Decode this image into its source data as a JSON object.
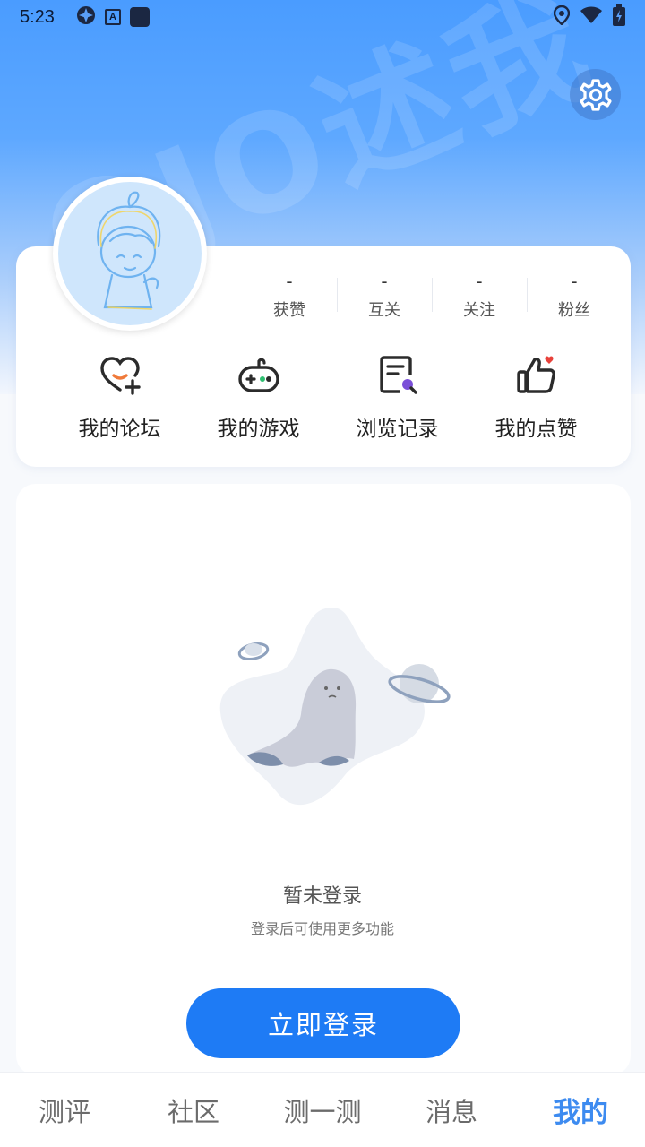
{
  "status_bar": {
    "time": "5:23"
  },
  "header": {
    "watermark_text": "OJO述我",
    "settings_icon": "gear-icon"
  },
  "profile": {
    "stats": [
      {
        "value": "-",
        "label": "获赞"
      },
      {
        "value": "-",
        "label": "互关"
      },
      {
        "value": "-",
        "label": "关注"
      },
      {
        "value": "-",
        "label": "粉丝"
      }
    ],
    "quick_actions": [
      {
        "label": "我的论坛",
        "icon": "heart-plus-icon"
      },
      {
        "label": "我的游戏",
        "icon": "gamepad-icon"
      },
      {
        "label": "浏览记录",
        "icon": "history-search-icon"
      },
      {
        "label": "我的点赞",
        "icon": "thumbs-up-icon"
      }
    ]
  },
  "empty_state": {
    "title": "暂未登录",
    "subtitle": "登录后可使用更多功能",
    "login_button": "立即登录"
  },
  "tabs": [
    {
      "label": "测评",
      "active": false
    },
    {
      "label": "社区",
      "active": false
    },
    {
      "label": "测一测",
      "active": false
    },
    {
      "label": "消息",
      "active": false
    },
    {
      "label": "我的",
      "active": true
    }
  ],
  "colors": {
    "accent": "#1e7bf5",
    "active_tab": "#3d8bf0",
    "header_top": "#4a9cff"
  }
}
